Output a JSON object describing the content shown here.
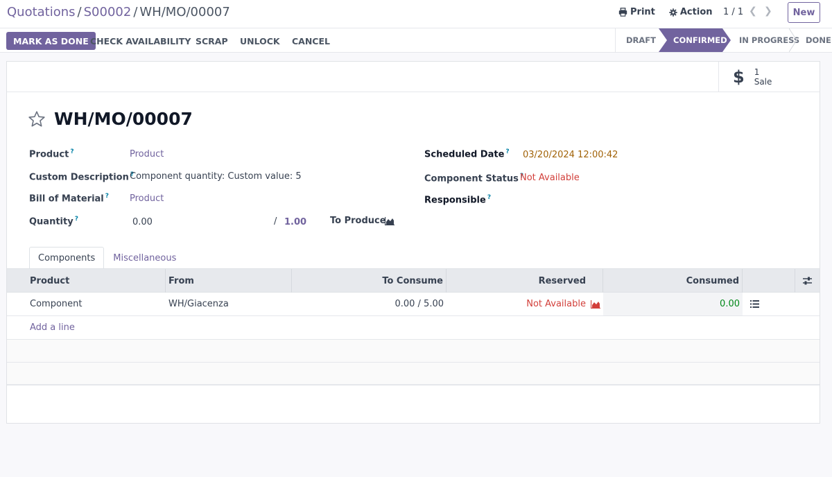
{
  "breadcrumb": {
    "parent": "Quotations",
    "order": "S00002",
    "current": "WH/MO/00007"
  },
  "top": {
    "print_label": "Print",
    "action_label": "Action",
    "pager": "1 / 1",
    "new_label": "New"
  },
  "actions": {
    "mark_done": "MARK AS DONE",
    "check_availability": "CHECK AVAILABILITY",
    "scrap": "SCRAP",
    "unlock": "UNLOCK",
    "cancel": "CANCEL"
  },
  "stages": [
    {
      "label": "DRAFT",
      "active": false
    },
    {
      "label": "CONFIRMED",
      "active": true
    },
    {
      "label": "IN PROGRESS",
      "active": false
    },
    {
      "label": "DONE",
      "active": false
    }
  ],
  "smart_button": {
    "count": "1",
    "label": "Sale"
  },
  "record": {
    "title": "WH/MO/00007"
  },
  "fields": {
    "product_label": "Product",
    "product_value": "Product",
    "custom_desc_label": "Custom Description",
    "custom_desc_value": "Component quantity: Custom value: 5",
    "bom_label": "Bill of Material",
    "bom_value": "Product",
    "quantity_label": "Quantity",
    "quantity_value": "0.00",
    "quantity_sep": "/",
    "quantity_total": "1.00",
    "to_produce_label": "To Produce",
    "scheduled_label": "Scheduled Date",
    "scheduled_value": "03/20/2024 12:00:42",
    "comp_status_label": "Component Status",
    "comp_status_value": "Not Available",
    "responsible_label": "Responsible",
    "help_mark": "?"
  },
  "tabs": [
    {
      "label": "Components",
      "active": true
    },
    {
      "label": "Miscellaneous",
      "active": false
    }
  ],
  "table": {
    "columns": [
      "Product",
      "From",
      "To Consume",
      "Reserved",
      "Consumed"
    ],
    "rows": [
      {
        "product": "Component",
        "from": "WH/Giacenza",
        "to_consume": "0.00 / 5.00",
        "reserved": "Not Available",
        "consumed": "0.00"
      }
    ],
    "add_line": "Add a line"
  },
  "colors": {
    "brand": "#71639e",
    "danger": "#d23f3a",
    "warning": "#a16207",
    "success": "#008818"
  }
}
